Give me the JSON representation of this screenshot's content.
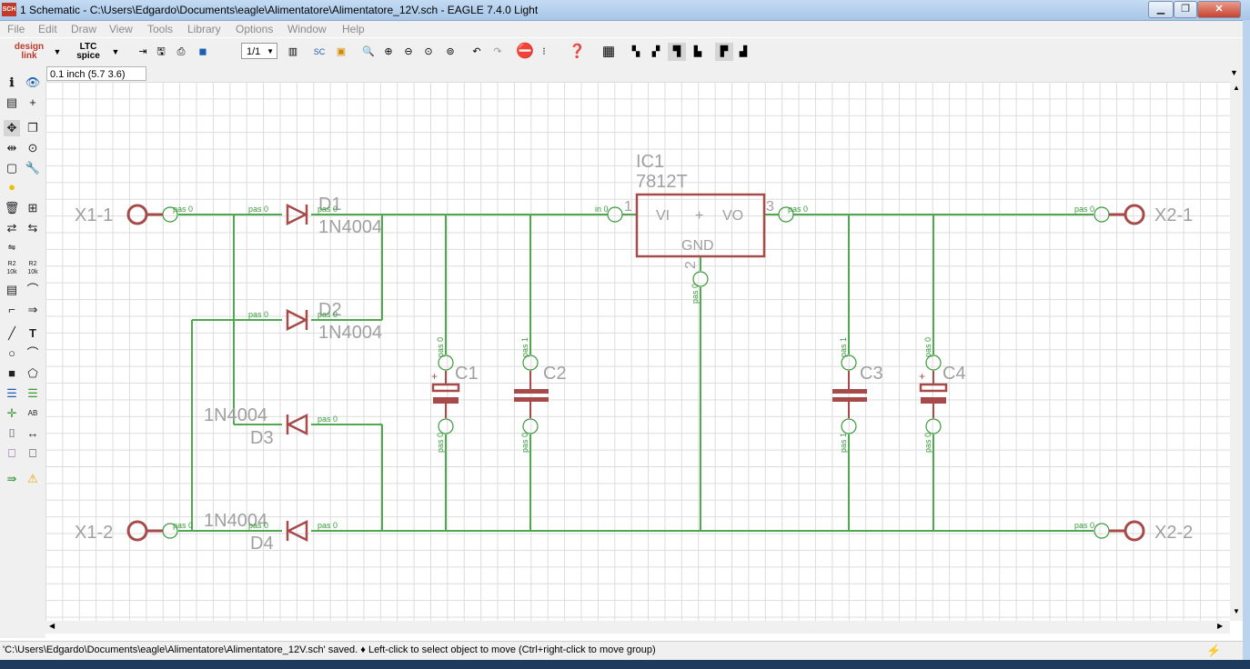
{
  "window": {
    "app_badge": "SCH",
    "title": "1 Schematic - C:\\Users\\Edgardo\\Documents\\eagle\\Alimentatore\\Alimentatore_12V.sch - EAGLE 7.4.0 Light",
    "minimize": "▁",
    "maximize": "❐",
    "close": "✕"
  },
  "menu": [
    "File",
    "Edit",
    "Draw",
    "View",
    "Tools",
    "Library",
    "Options",
    "Window",
    "Help"
  ],
  "toolbar": {
    "designlink": "design link",
    "ltspice": "LTC spice",
    "sheet_select": "1/1"
  },
  "coord_display": "0.1 inch (5.7 3.6)",
  "status_text": "'C:\\Users\\Edgardo\\Documents\\eagle\\Alimentatore\\Alimentatore_12V.sch' saved.  ♦ Left-click to select object to move (Ctrl+right-click to move group)",
  "schematic": {
    "connectors": {
      "x1_1": "X1-1",
      "x1_2": "X1-2",
      "x2_1": "X2-1",
      "x2_2": "X2-2"
    },
    "pin_label": "pas 0",
    "pin_label_1": "pas 1",
    "regulator": {
      "name": "IC1",
      "value": "7812T",
      "vi": "VI",
      "vo": "VO",
      "gnd": "GND",
      "pin_in": "in 0",
      "pin1": "1",
      "pin2": "2",
      "pin3": "3",
      "center": "+"
    },
    "diodes": {
      "d1": "D1",
      "d2": "D2",
      "d3": "D3",
      "d4": "D4",
      "value": "1N4004"
    },
    "caps": {
      "c1": "C1",
      "c2": "C2",
      "c3": "C3",
      "c4": "C4",
      "plus": "+"
    }
  },
  "colors": {
    "wire": "#4fa84f",
    "part": "#a64a4a",
    "pin": "#3a9a3a",
    "label": "#a0a0a0"
  }
}
